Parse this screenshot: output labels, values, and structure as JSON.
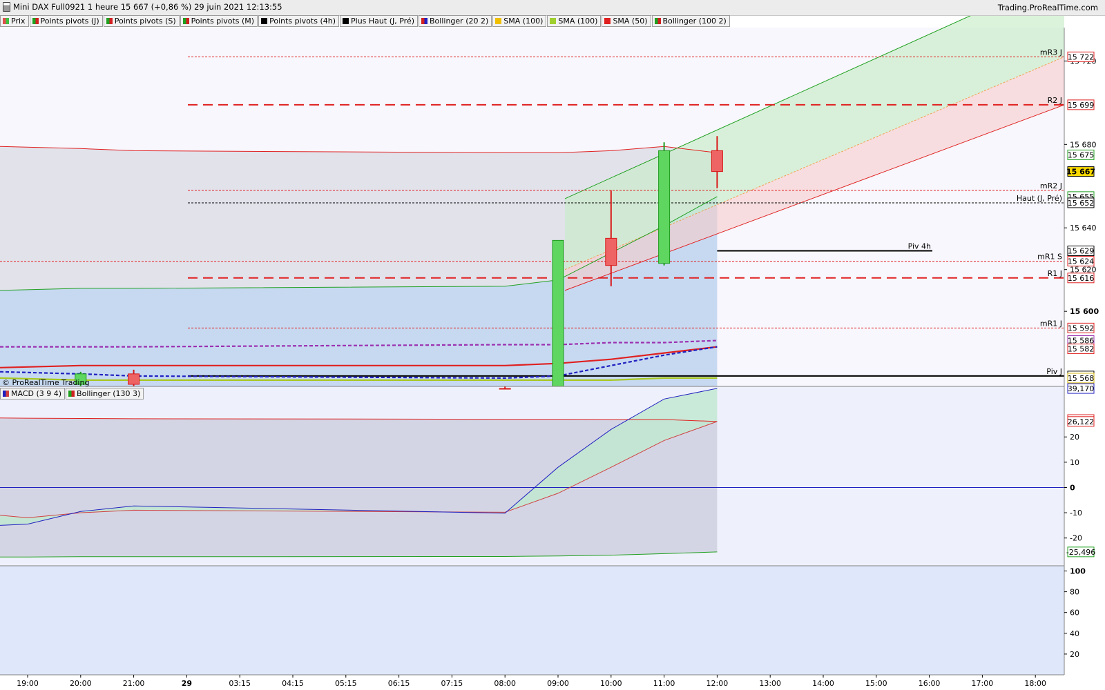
{
  "window": {
    "title": "Mini DAX Full0921 1 heure 15 667 (+0,86 %) 29 juin 2021 12:13:55",
    "brand": "Trading.ProRealTime.com",
    "watermark": "© ProRealTime Trading"
  },
  "price_legend": [
    {
      "label": "Prix",
      "colors": [
        "#e05050",
        "#40c040"
      ]
    },
    {
      "label": "Points pivots (J)",
      "colors": [
        "#20a020",
        "#d02020"
      ]
    },
    {
      "label": "Points pivots (S)",
      "colors": [
        "#20a020",
        "#d02020"
      ]
    },
    {
      "label": "Points pivots (M)",
      "colors": [
        "#20a020",
        "#d02020"
      ]
    },
    {
      "label": "Points pivots (4h)",
      "colors": [
        "#000000"
      ]
    },
    {
      "label": "Plus Haut (J, Pré)",
      "colors": [
        "#000000"
      ]
    },
    {
      "label": "Bollinger (20 2)",
      "colors": [
        "#d02020",
        "#2020c0"
      ]
    },
    {
      "label": "SMA (100)",
      "colors": [
        "#f0c000"
      ]
    },
    {
      "label": "SMA (100)",
      "colors": [
        "#a0d030"
      ]
    },
    {
      "label": "SMA (50)",
      "colors": [
        "#e02020"
      ]
    },
    {
      "label": "Bollinger (100 2)",
      "colors": [
        "#20a020",
        "#d02020"
      ]
    }
  ],
  "macd_legend": [
    {
      "label": "MACD (3 9 4)",
      "colors": [
        "#2020c0",
        "#d04040"
      ]
    },
    {
      "label": "Bollinger (130 3)",
      "colors": [
        "#20a020",
        "#d02020"
      ]
    }
  ],
  "chart_data": [
    {
      "type": "candlestick",
      "title": "Mini DAX Full0921 1 heure",
      "x_ticks": [
        "19:00",
        "20:00",
        "21:00",
        "29",
        "03:15",
        "04:15",
        "05:15",
        "06:15",
        "07:15",
        "08:00",
        "09:00",
        "10:00",
        "11:00",
        "12:00",
        "13:00",
        "14:00",
        "15:00",
        "16:00",
        "17:00",
        "18:00"
      ],
      "ylim": [
        15564,
        15736
      ],
      "y_ticks": [
        15600,
        15620,
        15640,
        15680,
        15720
      ],
      "candles": [
        {
          "time": "20:00",
          "open": 15565,
          "high": 15571,
          "low": 15560,
          "close": 15570
        },
        {
          "time": "21:00",
          "open": 15570,
          "high": 15572,
          "low": 15560,
          "close": 15565
        },
        {
          "time": "08:00",
          "open": 15563,
          "high": 15563,
          "low": 15555,
          "close": 15558
        },
        {
          "time": "09:00",
          "open": 15560,
          "high": 15634,
          "low": 15558,
          "close": 15634
        },
        {
          "time": "10:00",
          "open": 15635,
          "high": 15658,
          "low": 15612,
          "close": 15622
        },
        {
          "time": "11:00",
          "open": 15623,
          "high": 15681,
          "low": 15622,
          "close": 15677
        },
        {
          "time": "12:00",
          "open": 15677,
          "high": 15684,
          "low": 15659,
          "close": 15667
        }
      ],
      "levels": [
        {
          "name": "mR3 J",
          "value": 15722,
          "color": "#e02020",
          "style": "dotted"
        },
        {
          "name": "R2 J",
          "value": 15699,
          "color": "#e02020",
          "style": "dashed-bold"
        },
        {
          "name": "mR2 J",
          "value": 15658,
          "color": "#e02020",
          "style": "dotted"
        },
        {
          "name": "Haut (J, Pré)",
          "value": 15652,
          "color": "#000000",
          "style": "dotted"
        },
        {
          "name": "Piv 4h",
          "value": 15629,
          "color": "#000000",
          "style": "solid"
        },
        {
          "name": "mR1 S",
          "value": 15624,
          "color": "#e02020",
          "style": "dotted"
        },
        {
          "name": "R1 J",
          "value": 15616,
          "color": "#e02020",
          "style": "dashed-bold"
        },
        {
          "name": "mR1 J",
          "value": 15592,
          "color": "#e02020",
          "style": "dotted"
        },
        {
          "name": "Piv J",
          "value": 15569,
          "color": "#000000",
          "style": "solid"
        }
      ],
      "series": [
        {
          "name": "Bollinger (100 2) upper",
          "color": "#e02020",
          "x": [
            "18:00",
            "20:00",
            "21:00",
            "08:00",
            "09:00",
            "10:00",
            "11:00",
            "12:00"
          ],
          "values": [
            15679,
            15678,
            15677,
            15676,
            15676,
            15677,
            15679,
            15676
          ]
        },
        {
          "name": "Bollinger (100 2) lower",
          "color": "#20a020",
          "x": [
            "18:00",
            "20:00",
            "21:00",
            "08:00",
            "09:00",
            "10:00",
            "11:00",
            "12:00"
          ],
          "values": [
            15610,
            15611,
            15611,
            15612,
            15615,
            15628,
            15641,
            15655
          ]
        },
        {
          "name": "SMA (50)",
          "color": "#e02020",
          "x": [
            "18:00",
            "20:00",
            "21:00",
            "08:00",
            "09:00",
            "10:00",
            "11:00",
            "12:00"
          ],
          "values": [
            15573,
            15574,
            15574,
            15574,
            15575,
            15577,
            15580,
            15583
          ]
        },
        {
          "name": "Bollinger (20 2) mid",
          "color": "#2020c0",
          "x": [
            "18:00",
            "20:00",
            "21:00",
            "08:00",
            "09:00",
            "10:00",
            "11:00",
            "12:00"
          ],
          "values": [
            15571,
            15570,
            15569,
            15568,
            15569,
            15574,
            15579,
            15583
          ]
        },
        {
          "name": "SMA (100)",
          "color": "#9c30b0",
          "x": [
            "18:00",
            "20:00",
            "21:00",
            "08:00",
            "09:00",
            "10:00",
            "11:00",
            "12:00"
          ],
          "values": [
            15583,
            15583,
            15583,
            15584,
            15584,
            15585,
            15585,
            15586
          ]
        },
        {
          "name": "SMA (100)",
          "color": "#a8c820",
          "x": [
            "18:00",
            "20:00",
            "21:00",
            "08:00",
            "09:00",
            "10:00",
            "11:00",
            "12:00"
          ],
          "values": [
            15568,
            15567,
            15567,
            15567,
            15567,
            15567,
            15568,
            15568
          ]
        }
      ],
      "channel": {
        "color_up": "#20a020",
        "color_down": "#e02020",
        "from": "09:00",
        "to": "18:00",
        "upper": [
          15654,
          15762
        ],
        "mid": [
          15620,
          15722
        ],
        "lower": [
          15610,
          15699
        ]
      },
      "value_tags": [
        {
          "value": 15722,
          "label": "15 722",
          "color": "#e02020"
        },
        {
          "value": 15699,
          "label": "15 699",
          "color": "#e02020"
        },
        {
          "value": 15675,
          "label": "15 675",
          "color": "#20a020"
        },
        {
          "value": 15667,
          "label": "15 667",
          "color": "#000000",
          "fill": "#f8d800"
        },
        {
          "value": 15655,
          "label": "15 655",
          "color": "#20a020"
        },
        {
          "value": 15652,
          "label": "15 652",
          "color": "#000000"
        },
        {
          "value": 15629,
          "label": "15 629",
          "color": "#000000"
        },
        {
          "value": 15624,
          "label": "15 624",
          "color": "#e02020"
        },
        {
          "value": 15616,
          "label": "15 616",
          "color": "#e02020"
        },
        {
          "value": 15592,
          "label": "15 592",
          "color": "#e02020"
        },
        {
          "value": 15586,
          "label": "15 586",
          "color": "#9c30b0"
        },
        {
          "value": 15582,
          "label": "15 582",
          "color": "#e02020"
        },
        {
          "value": 15569,
          "label": "15 569",
          "color": "#000000"
        },
        {
          "value": 15568,
          "label": "15 568",
          "color": "#d0b000"
        }
      ]
    },
    {
      "type": "line",
      "title": "MACD (3 9 4)",
      "ylim": [
        -31,
        40
      ],
      "y_ticks": [
        20,
        10,
        0,
        -10,
        -20
      ],
      "x": [
        "18:00",
        "19:00",
        "20:00",
        "21:00",
        "08:00",
        "09:00",
        "10:00",
        "11:00",
        "12:00"
      ],
      "series": [
        {
          "name": "MACD",
          "color": "#2020c0",
          "values": [
            -15,
            -14.5,
            -9.5,
            -7.3,
            -10.2,
            8,
            23,
            35,
            39.2
          ]
        },
        {
          "name": "Signal",
          "color": "#d04040",
          "values": [
            -11,
            -12,
            -10,
            -9,
            -9.8,
            -2.3,
            8,
            18.6,
            26.1
          ]
        },
        {
          "name": "Bollinger (130 3) upper",
          "color": "#e02020",
          "values": [
            27.5,
            27.4,
            27.3,
            27.2,
            27,
            27,
            26.9,
            26.9,
            26.1
          ]
        },
        {
          "name": "Bollinger (130 3) lower",
          "color": "#20a020",
          "values": [
            -27.5,
            -27.5,
            -27.4,
            -27.4,
            -27.3,
            -27.1,
            -26.8,
            -26.2,
            -25.5
          ]
        }
      ],
      "value_tags": [
        {
          "value": 39.17,
          "label": "39,170",
          "color": "#2020c0"
        },
        {
          "value": 26.886,
          "label": "26,886",
          "color": "#e02020"
        },
        {
          "value": 26.122,
          "label": "26,122",
          "color": "#e02020"
        },
        {
          "value": -25.496,
          "label": "-25,496",
          "color": "#20a020"
        }
      ],
      "zero_line_color": "#2020c0"
    },
    {
      "type": "line",
      "title": "",
      "y_ticks": [
        100,
        80,
        60,
        40,
        20
      ],
      "ylim": [
        0,
        105
      ],
      "series": []
    }
  ]
}
